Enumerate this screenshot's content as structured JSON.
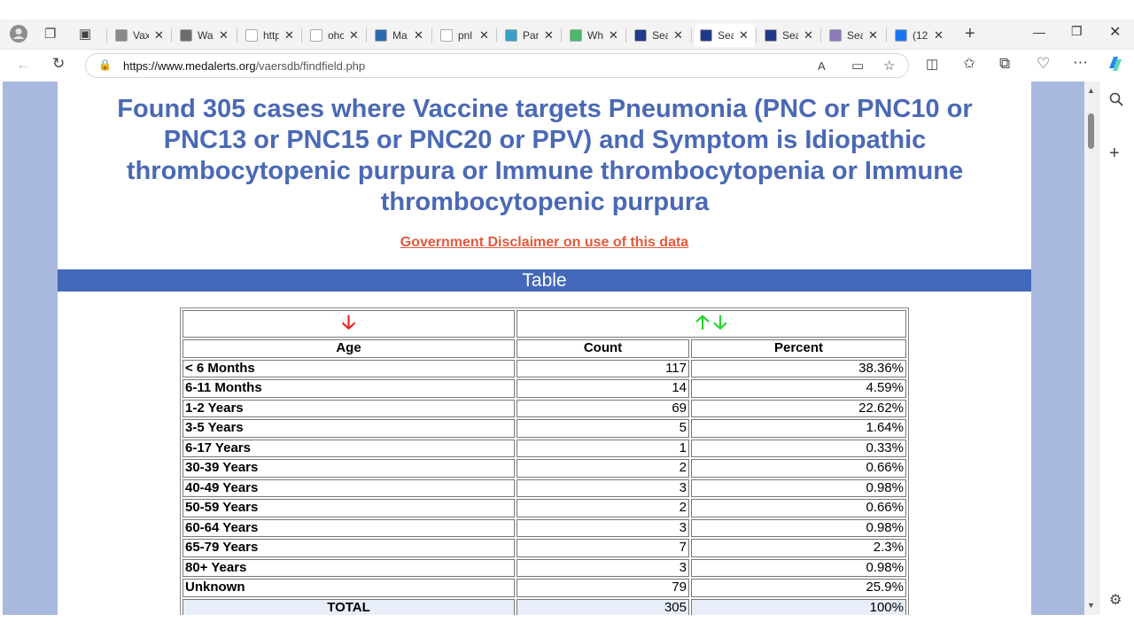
{
  "browser": {
    "tabs": [
      {
        "label": "Vax",
        "color": "#8a8a8a"
      },
      {
        "label": "Wa",
        "color": "#6d6d6d"
      },
      {
        "label": "http",
        "color": "#ffffff"
      },
      {
        "label": "ohc",
        "color": "#ffffff"
      },
      {
        "label": "Ma",
        "color": "#2b6cb0"
      },
      {
        "label": "pnl",
        "color": "#ffffff"
      },
      {
        "label": "Par",
        "color": "#3aa0c8"
      },
      {
        "label": "Wh",
        "color": "#4ab86a"
      },
      {
        "label": "Sea",
        "color": "#1f3a8a"
      },
      {
        "label": "Sea",
        "color": "#1f3a8a",
        "active": true
      },
      {
        "label": "Sea",
        "color": "#1f3a8a"
      },
      {
        "label": "Sea",
        "color": "#8a7ab8"
      },
      {
        "label": "(12",
        "color": "#1877f2"
      }
    ],
    "url_host": "https://www.medalerts.org",
    "url_path": "/vaersdb/findfield.php"
  },
  "page": {
    "title": "Found 305 cases where Vaccine targets Pneumonia (PNC or PNC10 or PNC13 or PNC15 or PNC20 or PPV) and Symptom is Idiopathic thrombocytopenic purpura or Immune thrombocytopenia or Immune thrombocytopenic purpura",
    "disclaimer": "Government Disclaimer on use of this data",
    "table_heading": "Table",
    "arrow_down": "🡣",
    "arrow_up": "🡡",
    "headers": {
      "age": "Age",
      "count": "Count",
      "percent": "Percent"
    },
    "rows": [
      {
        "age": "< 6 Months",
        "count": "117",
        "percent": "38.36%"
      },
      {
        "age": "6-11 Months",
        "count": "14",
        "percent": "4.59%"
      },
      {
        "age": "1-2 Years",
        "count": "69",
        "percent": "22.62%"
      },
      {
        "age": "3-5 Years",
        "count": "5",
        "percent": "1.64%"
      },
      {
        "age": "6-17 Years",
        "count": "1",
        "percent": "0.33%"
      },
      {
        "age": "30-39 Years",
        "count": "2",
        "percent": "0.66%"
      },
      {
        "age": "40-49 Years",
        "count": "3",
        "percent": "0.98%"
      },
      {
        "age": "50-59 Years",
        "count": "2",
        "percent": "0.66%"
      },
      {
        "age": "60-64 Years",
        "count": "3",
        "percent": "0.98%"
      },
      {
        "age": "65-79 Years",
        "count": "7",
        "percent": "2.3%"
      },
      {
        "age": "80+ Years",
        "count": "3",
        "percent": "0.98%"
      },
      {
        "age": "Unknown",
        "count": "79",
        "percent": "25.9%"
      }
    ],
    "total": {
      "age": "TOTAL",
      "count": "305",
      "percent": "100%"
    }
  },
  "colors": {
    "title": "#4a69b5",
    "table_bar": "#4469ba",
    "page_side": "#a9b9df",
    "disclaimer": "#e05a3a",
    "arrow_red": "#e8231b",
    "arrow_green": "#22d42e"
  }
}
